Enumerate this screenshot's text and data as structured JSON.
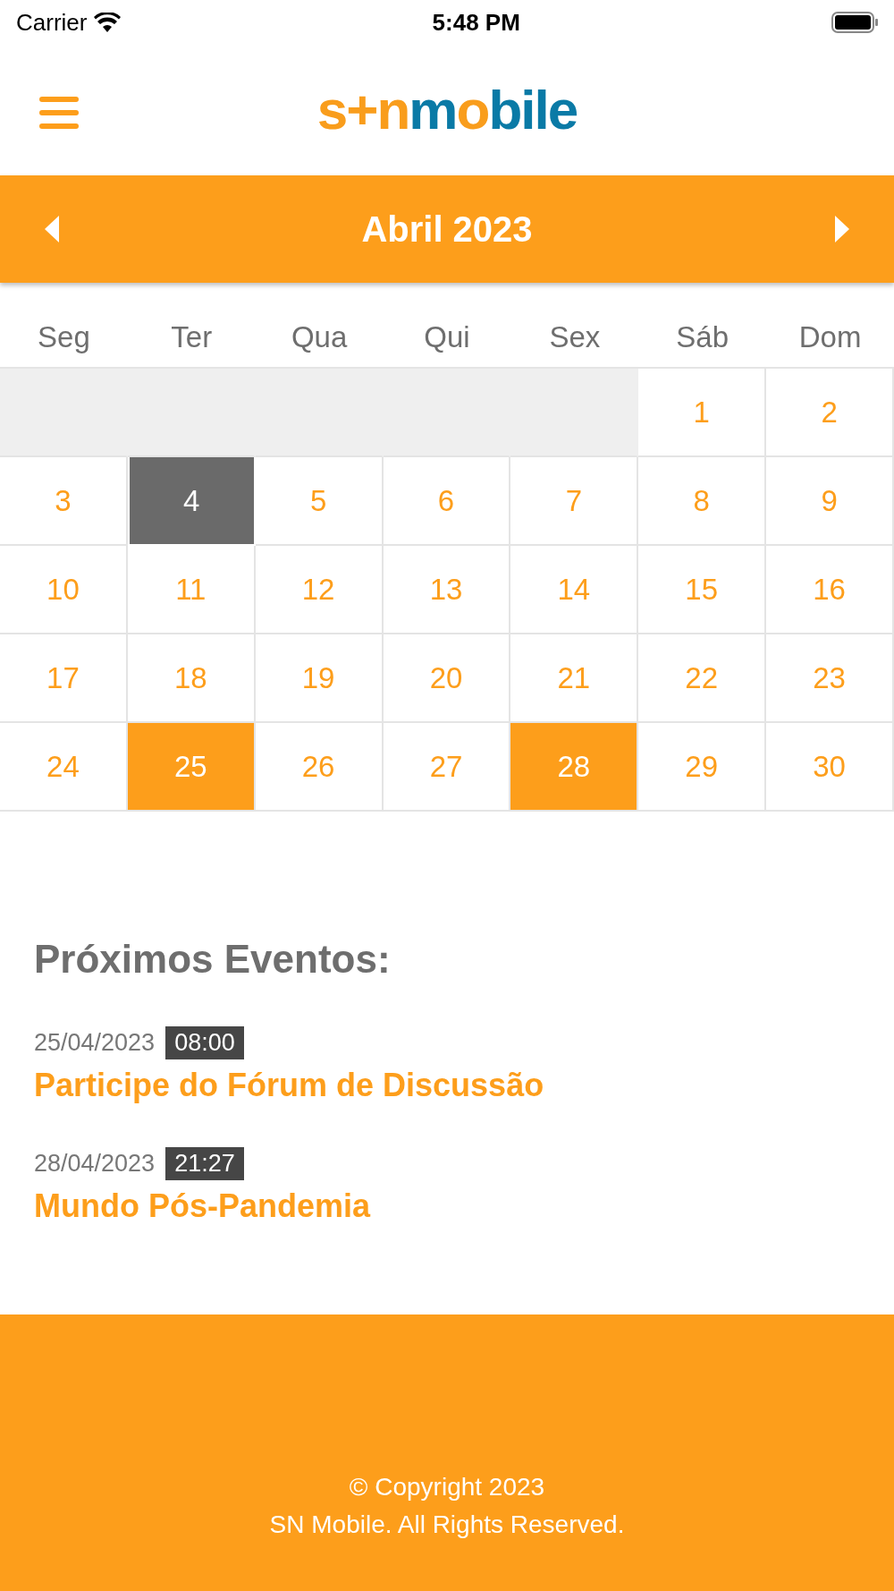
{
  "status_bar": {
    "carrier": "Carrier",
    "time": "5:48 PM"
  },
  "header": {
    "logo": [
      {
        "text": "s+n",
        "color": "#f99d1c"
      },
      {
        "text": "m",
        "color": "#0a7aa6"
      },
      {
        "text": "o",
        "color": "#f99d1c"
      },
      {
        "text": "bile",
        "color": "#0a7aa6"
      }
    ]
  },
  "calendar": {
    "month_title": "Abril 2023",
    "weekdays": [
      "Seg",
      "Ter",
      "Qua",
      "Qui",
      "Sex",
      "Sáb",
      "Dom"
    ],
    "days": [
      {
        "kind": "blank"
      },
      {
        "kind": "blank"
      },
      {
        "kind": "blank"
      },
      {
        "kind": "blank"
      },
      {
        "kind": "blank"
      },
      {
        "kind": "day",
        "label": "1"
      },
      {
        "kind": "day",
        "label": "2"
      },
      {
        "kind": "day",
        "label": "3"
      },
      {
        "kind": "today",
        "label": "4"
      },
      {
        "kind": "day",
        "label": "5"
      },
      {
        "kind": "day",
        "label": "6"
      },
      {
        "kind": "day",
        "label": "7"
      },
      {
        "kind": "day",
        "label": "8"
      },
      {
        "kind": "day",
        "label": "9"
      },
      {
        "kind": "day",
        "label": "10"
      },
      {
        "kind": "day",
        "label": "11"
      },
      {
        "kind": "day",
        "label": "12"
      },
      {
        "kind": "day",
        "label": "13"
      },
      {
        "kind": "day",
        "label": "14"
      },
      {
        "kind": "day",
        "label": "15"
      },
      {
        "kind": "day",
        "label": "16"
      },
      {
        "kind": "day",
        "label": "17"
      },
      {
        "kind": "day",
        "label": "18"
      },
      {
        "kind": "day",
        "label": "19"
      },
      {
        "kind": "day",
        "label": "20"
      },
      {
        "kind": "day",
        "label": "21"
      },
      {
        "kind": "day",
        "label": "22"
      },
      {
        "kind": "day",
        "label": "23"
      },
      {
        "kind": "day",
        "label": "24"
      },
      {
        "kind": "event",
        "label": "25"
      },
      {
        "kind": "day",
        "label": "26"
      },
      {
        "kind": "day",
        "label": "27"
      },
      {
        "kind": "event",
        "label": "28"
      },
      {
        "kind": "day",
        "label": "29"
      },
      {
        "kind": "day",
        "label": "30"
      }
    ]
  },
  "events": {
    "heading": "Próximos Eventos:",
    "items": [
      {
        "date": "25/04/2023",
        "time": "08:00",
        "title": "Participe do Fórum de Discussão"
      },
      {
        "date": "28/04/2023",
        "time": "21:27",
        "title": "Mundo Pós-Pandemia"
      }
    ]
  },
  "footer": {
    "lines": [
      "© Copyright 2023",
      "SN Mobile. All Rights Reserved."
    ]
  }
}
